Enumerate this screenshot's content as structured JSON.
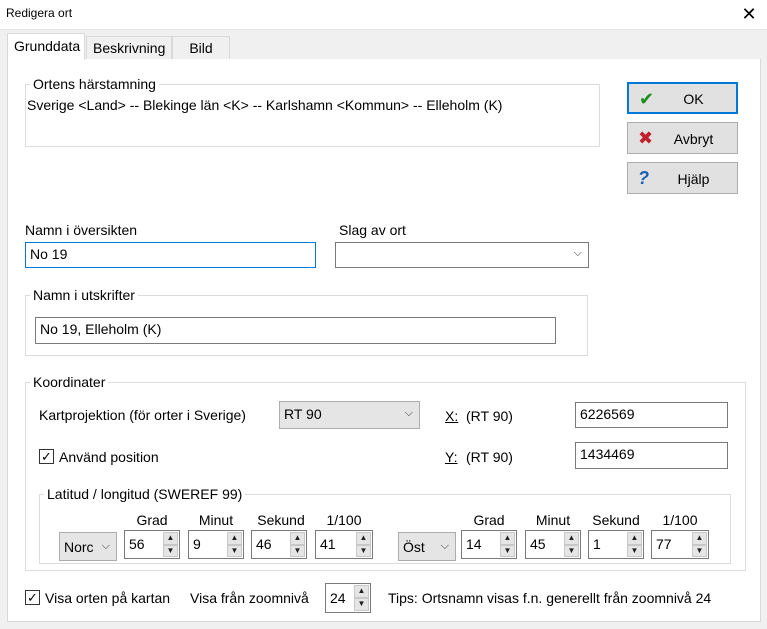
{
  "window": {
    "title": "Redigera ort",
    "close_icon": "close-icon"
  },
  "tabs": [
    {
      "label": "Grunddata",
      "active": true
    },
    {
      "label": "Beskrivning",
      "active": false
    },
    {
      "label": "Bild",
      "active": false
    }
  ],
  "origin": {
    "legend": "Ortens härstamning",
    "text": "Sverige <Land> -- Blekinge län <K> -- Karlshamn <Kommun> -- Elleholm (K)"
  },
  "buttons": {
    "ok": "OK",
    "cancel": "Avbryt",
    "help": "Hjälp"
  },
  "name_overview": {
    "label": "Namn i översikten",
    "value": "No 19"
  },
  "place_type": {
    "label": "Slag av ort",
    "value": ""
  },
  "name_print": {
    "legend": "Namn i utskrifter",
    "value": "No 19, Elleholm (K)"
  },
  "coordinates": {
    "legend": "Koordinater",
    "projection_label": "Kartprojektion (för orter i Sverige)",
    "projection_value": "RT 90",
    "x_label": "X:",
    "x_unit": "(RT 90)",
    "x_value": "6226569",
    "y_label": "Y:",
    "y_unit": "(RT 90)",
    "y_value": "1434469",
    "use_position_label": "Använd position",
    "use_position_checked": true
  },
  "latlong": {
    "legend": "Latitud / longitud (SWEREF 99)",
    "headers": [
      "Grad",
      "Minut",
      "Sekund",
      "1/100"
    ],
    "lat_dir": "Norc",
    "lat": [
      "56",
      "9",
      "46",
      "41"
    ],
    "lon_dir": "Öst",
    "lon": [
      "14",
      "45",
      "1",
      "77"
    ]
  },
  "footer": {
    "show_on_map_label": "Visa orten på kartan",
    "show_on_map_checked": true,
    "zoom_label": "Visa från zoomnivå",
    "zoom_value": "24",
    "tip": "Tips: Ortsnamn visas f.n. generellt från zoomnivå 24"
  }
}
